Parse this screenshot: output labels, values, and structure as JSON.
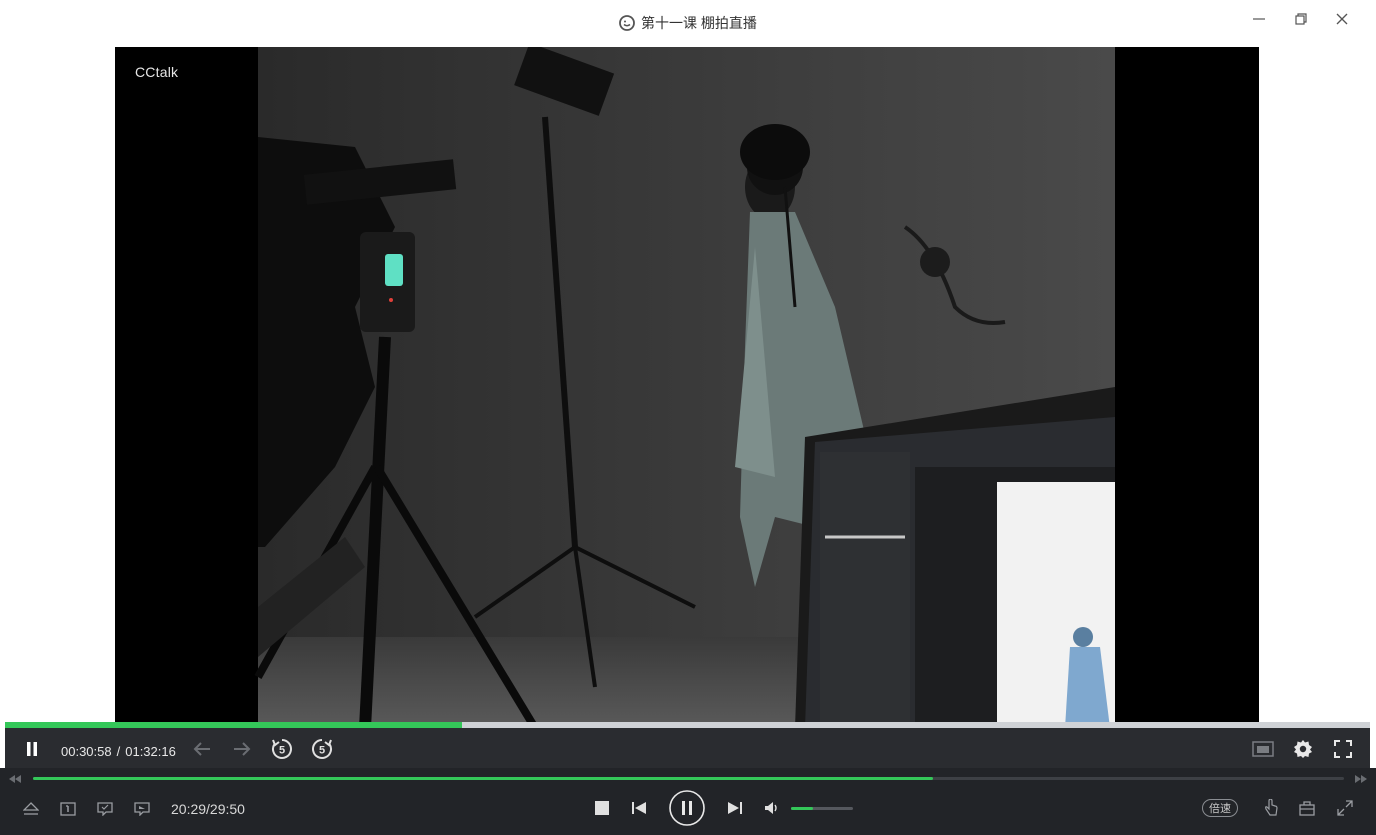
{
  "window": {
    "title": "第十一课 棚拍直播",
    "icons": [
      "app-logo-icon",
      "minimize-icon",
      "restore-icon",
      "close-icon"
    ]
  },
  "video": {
    "watermark": "CCtalk",
    "top_progress_fraction": 0.335
  },
  "controls": {
    "current_time": "00:30:58",
    "separator": "/",
    "total_time": "01:32:16",
    "icons": [
      "pause-icon",
      "back-arrow-icon",
      "forward-arrow-icon",
      "rewind-5s-icon",
      "forward-5s-icon",
      "pip-icon",
      "settings-icon",
      "fullscreen-icon"
    ]
  },
  "player_bar": {
    "elapsed": "20:29/29:50",
    "seek_fraction": 0.6865,
    "volume_fraction": 0.35,
    "speed_label": "倍速",
    "icons": [
      "eject-icon",
      "subtitle-icon",
      "screenshot-icon",
      "record-icon",
      "stop-icon",
      "prev-icon",
      "pause-circle-icon",
      "next-icon",
      "volume-icon",
      "hand-icon",
      "toolbox-icon",
      "expand-icon"
    ]
  },
  "colors": {
    "accent": "#34c759",
    "control_bg": "#2a2c30",
    "bottom_bg": "#222428"
  }
}
